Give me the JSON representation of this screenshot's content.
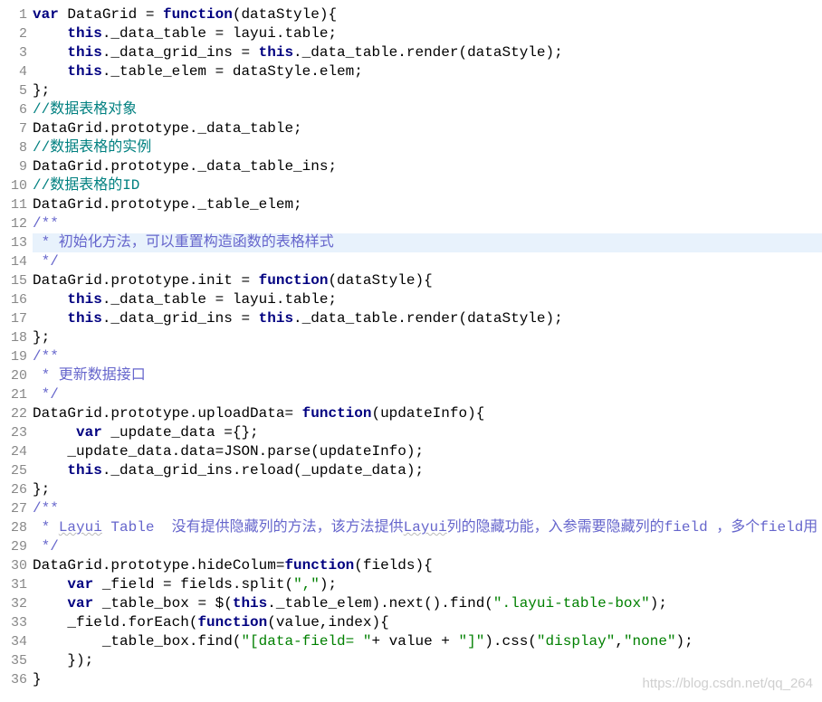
{
  "lineNumbers": [
    "1",
    "2",
    "3",
    "4",
    "5",
    "6",
    "7",
    "8",
    "9",
    "10",
    "11",
    "12",
    "13",
    "14",
    "15",
    "16",
    "17",
    "18",
    "19",
    "20",
    "21",
    "22",
    "23",
    "24",
    "25",
    "26",
    "27",
    "28",
    "29",
    "30",
    "31",
    "32",
    "33",
    "34",
    "35",
    "36"
  ],
  "highlightedLine": 13,
  "watermark": "https://blog.csdn.net/qq_264",
  "code": {
    "l1": {
      "p0": "var",
      "p1": " DataGrid = ",
      "p2": "function",
      "p3": "(dataStyle){"
    },
    "l2": {
      "p0": "    ",
      "p1": "this",
      "p2": "._data_table = layui.table;"
    },
    "l3": {
      "p0": "    ",
      "p1": "this",
      "p2": "._data_grid_ins = ",
      "p3": "this",
      "p4": "._data_table.render(dataStyle);"
    },
    "l4": {
      "p0": "    ",
      "p1": "this",
      "p2": "._table_elem = dataStyle.elem;"
    },
    "l5": {
      "p0": "};"
    },
    "l6": {
      "p0": "//数据表格对象"
    },
    "l7": {
      "p0": "DataGrid.prototype._data_table;"
    },
    "l8": {
      "p0": "//数据表格的实例"
    },
    "l9": {
      "p0": "DataGrid.prototype._data_table_ins;"
    },
    "l10": {
      "p0": "//数据表格的ID"
    },
    "l11": {
      "p0": "DataGrid.prototype._table_elem;"
    },
    "l12": {
      "p0": "/**"
    },
    "l13": {
      "p0": " * 初始化方法，可以重置构造函数的表格样式"
    },
    "l14": {
      "p0": " */"
    },
    "l15": {
      "p0": "DataGrid.prototype.init = ",
      "p1": "function",
      "p2": "(dataStyle){"
    },
    "l16": {
      "p0": "    ",
      "p1": "this",
      "p2": "._data_table = layui.table;"
    },
    "l17": {
      "p0": "    ",
      "p1": "this",
      "p2": "._data_grid_ins = ",
      "p3": "this",
      "p4": "._data_table.render(dataStyle);"
    },
    "l18": {
      "p0": "};"
    },
    "l19": {
      "p0": "/**"
    },
    "l20": {
      "p0": " * 更新数据接口"
    },
    "l21": {
      "p0": " */"
    },
    "l22": {
      "p0": "DataGrid.prototype.uploadData= ",
      "p1": "function",
      "p2": "(updateInfo){"
    },
    "l23": {
      "p0": "     ",
      "p1": "var",
      "p2": " _update_data ={};"
    },
    "l24": {
      "p0": "    _update_data.data=JSON.parse(updateInfo);"
    },
    "l25": {
      "p0": "    ",
      "p1": "this",
      "p2": "._data_grid_ins.reload(_update_data);"
    },
    "l26": {
      "p0": "};"
    },
    "l27": {
      "p0": "/**"
    },
    "l28": {
      "p0": " * ",
      "p1": "Layui",
      "p2": " Table  没有提供隐藏列的方法，该方法提供",
      "p3": "Layui",
      "p4": "列的隐藏功能，入参需要隐藏列的field ，多个field用 ，号隔开"
    },
    "l29": {
      "p0": " */"
    },
    "l30": {
      "p0": "DataGrid.prototype.hideColum=",
      "p1": "function",
      "p2": "(fields){"
    },
    "l31": {
      "p0": "    ",
      "p1": "var",
      "p2": " _field = fields.split(",
      "p3": "\",\"",
      "p4": ");"
    },
    "l32": {
      "p0": "    ",
      "p1": "var",
      "p2": " _table_box = $(",
      "p3": "this",
      "p4": "._table_elem).next().find(",
      "p5": "\".layui-table-box\"",
      "p6": ");"
    },
    "l33": {
      "p0": "    _field.forEach(",
      "p1": "function",
      "p2": "(value,index){"
    },
    "l34": {
      "p0": "        _table_box.find(",
      "p1": "\"[data-field= \"",
      "p2": "+ value + ",
      "p3": "\"]\"",
      "p4": ").css(",
      "p5": "\"display\"",
      "p6": ",",
      "p7": "\"none\"",
      "p8": ");"
    },
    "l35": {
      "p0": "    });"
    },
    "l36": {
      "p0": "}"
    }
  }
}
